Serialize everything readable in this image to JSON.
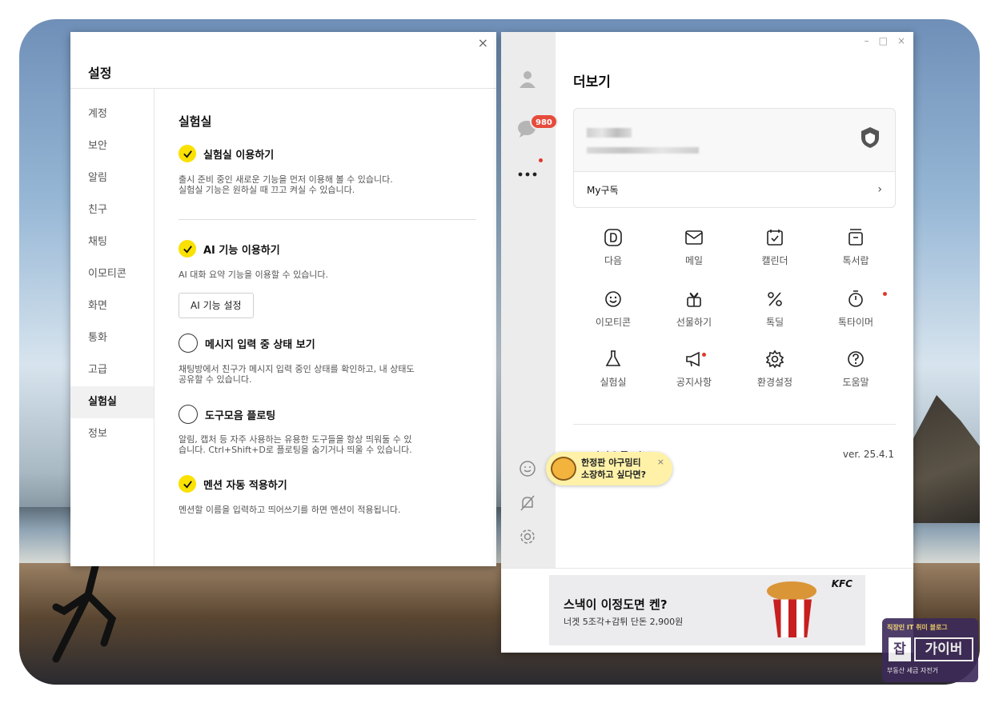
{
  "settings": {
    "title": "설정",
    "close": "×",
    "nav": [
      "계정",
      "보안",
      "알림",
      "친구",
      "채팅",
      "이모티콘",
      "화면",
      "통화",
      "고급",
      "실험실",
      "정보"
    ],
    "active_index": 9,
    "section_title": "실험실",
    "options": [
      {
        "label": "실험실 이용하기",
        "checked": true,
        "desc": "출시 준비 중인 새로운 기능을 먼저 이용해 볼 수 있습니다.\n실험실 기능은 원하실 때 끄고 켜실 수 있습니다."
      },
      {
        "label": "AI 기능 이용하기",
        "checked": true,
        "desc": "AI 대화 요약 기능을 이용할 수 있습니다.",
        "button": "AI 기능 설정"
      },
      {
        "label": "메시지 입력 중 상태 보기",
        "checked": false,
        "desc": "채팅방에서 친구가 메시지 입력 중인 상태를 확인하고, 내 상태도\n공유할 수 있습니다."
      },
      {
        "label": "도구모음 플로팅",
        "checked": false,
        "desc": "알림, 캡처 등 자주 사용하는 유용한 도구들을 항상 띄워둘 수 있\n습니다. Ctrl+Shift+D로 플로팅을 숨기거나 띄울 수 있습니다."
      },
      {
        "label": "멘션 자동 적용하기",
        "checked": true,
        "desc": "멘션할 이름을 입력하고 띄어쓰기를 하면 멘션이 적용됩니다."
      }
    ]
  },
  "kakao": {
    "window_controls": [
      "–",
      "□",
      "×"
    ],
    "badge": "980",
    "title": "더보기",
    "my_subscription": "My구독",
    "grid": [
      {
        "label": "다음",
        "icon": "daum-icon"
      },
      {
        "label": "메일",
        "icon": "mail-icon"
      },
      {
        "label": "캘린더",
        "icon": "calendar-icon"
      },
      {
        "label": "톡서랍",
        "icon": "drawer-icon"
      },
      {
        "label": "이모티콘",
        "icon": "emoticon-icon"
      },
      {
        "label": "선물하기",
        "icon": "gift-icon"
      },
      {
        "label": "톡딜",
        "icon": "talkdeal-icon"
      },
      {
        "label": "톡타이머",
        "icon": "timer-icon"
      },
      {
        "label": "실험실",
        "icon": "flask-icon"
      },
      {
        "label": "공지사항",
        "icon": "megaphone-icon"
      },
      {
        "label": "환경설정",
        "icon": "settings-icon"
      },
      {
        "label": "도움말",
        "icon": "help-icon"
      }
    ],
    "info_label": "카카오톡 정보",
    "version": "ver. 25.4.1",
    "tooltip": {
      "line1": "한정판 야구밈티",
      "line2": "소장하고 싶다면?",
      "close": "×"
    },
    "ad": {
      "headline": "스낵이 이정도면 켄?",
      "sub": "너겟 5조각+감튀 단돈 2,900원",
      "brand": "KFC"
    }
  },
  "watermark": {
    "top": "직장인 IT 취미 블로그",
    "jab": "잡",
    "main": "가이버",
    "bottom": "부동산 세금 자전거"
  },
  "colors": {
    "accent_yellow": "#fae100",
    "badge_red": "#e64b3c"
  }
}
